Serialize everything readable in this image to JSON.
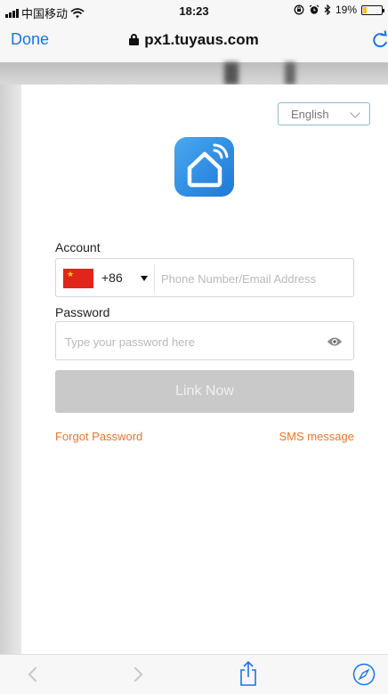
{
  "status_bar": {
    "carrier": "中国移动",
    "time": "18:23",
    "battery": "19%",
    "battery_level": 0.19,
    "icons": [
      "signal-icon",
      "wifi-icon",
      "lock-rotation-icon",
      "alarm-icon",
      "bluetooth-icon",
      "battery-icon"
    ]
  },
  "nav": {
    "done_label": "Done",
    "url": "px1.tuyaus.com",
    "icons": [
      "lock-icon",
      "reload-icon"
    ]
  },
  "form": {
    "language": "English",
    "account_label": "Account",
    "country_code": "+86",
    "account_placeholder": "Phone Number/Email Address",
    "password_label": "Password",
    "password_placeholder": "Type your password here",
    "submit_label": "Link Now",
    "forgot_label": "Forgot Password",
    "sms_label": "SMS message",
    "icons": [
      "app-logo-icon",
      "china-flag-icon",
      "caret-down-icon",
      "eye-icon"
    ]
  },
  "toolbar": {
    "icons": [
      "back-icon",
      "forward-icon",
      "share-icon",
      "compass-icon"
    ]
  },
  "colors": {
    "accent_blue": "#1a73e8",
    "link_orange": "#e8762b",
    "button_disabled": "#c9c9c9",
    "logo_blue": "#2f8fe6"
  }
}
